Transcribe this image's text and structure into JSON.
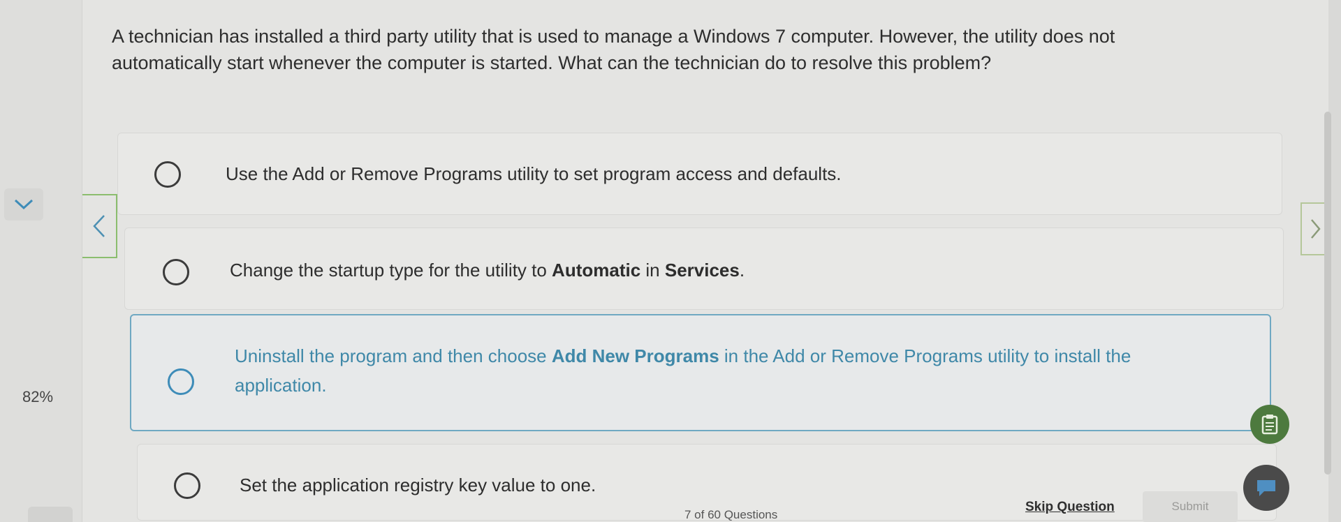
{
  "question": {
    "text": "A technician has installed a third party utility that is used to manage a Windows 7 computer. However, the utility does not automatically start whenever the computer is started. What can the technician do to resolve this problem?"
  },
  "options": [
    {
      "selected": false,
      "text_parts": [
        "Use the Add or Remove Programs utility to set program access and defaults."
      ]
    },
    {
      "selected": false,
      "text_parts": [
        "Change the startup type for the utility to ",
        "Automatic",
        " in ",
        "Services",
        "."
      ]
    },
    {
      "selected": true,
      "text_parts": [
        "Uninstall the program and then choose ",
        "Add New Programs",
        " in the Add or Remove Programs utility to install the application."
      ]
    },
    {
      "selected": false,
      "text_parts": [
        "Set the application registry key value to one."
      ]
    }
  ],
  "progress": {
    "percent_label": "82%"
  },
  "footer": {
    "question_count": "7 of 60 Questions",
    "skip_label": "Skip Question",
    "submit_label": "Submit"
  },
  "icons": {
    "collapse": "chevron-down-icon",
    "prev": "chevron-left-icon",
    "next": "chevron-right-icon",
    "notes": "clipboard-icon",
    "chat": "chat-icon"
  },
  "colors": {
    "selected_accent": "#3f88a8",
    "nav_accent": "#8bbd6e",
    "notes_fab": "#4d7a3e"
  }
}
